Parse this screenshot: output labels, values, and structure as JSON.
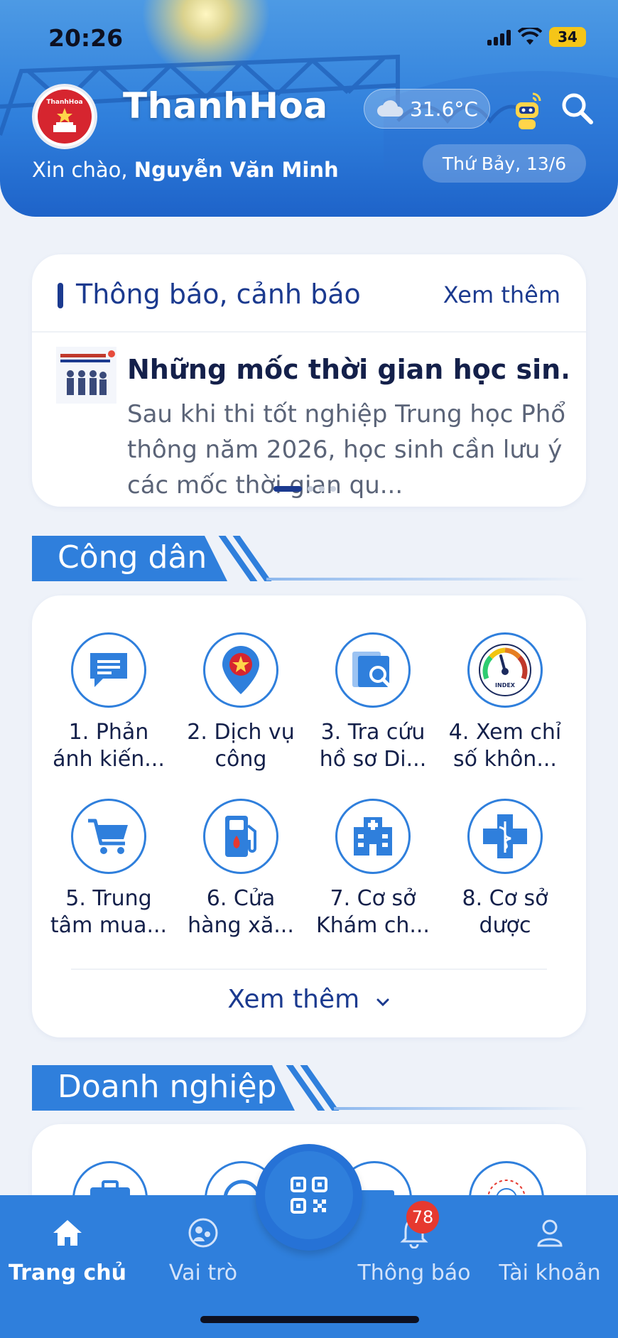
{
  "status_bar": {
    "time": "20:26",
    "battery": "34"
  },
  "header": {
    "app_title": "ThanhHoa",
    "logo_text": "ThanhHoa",
    "temperature": "31.6°C",
    "greeting_prefix": "Xin chào, ",
    "user_name": "Nguyễn Văn Minh",
    "date": "Thứ Bảy, 13/6"
  },
  "notice": {
    "title": "Thông báo, cảnh báo",
    "more_label": "Xem thêm",
    "headline": "Những mốc thời gian học sin...",
    "body": "Sau khi thi tốt nghiệp Trung học Phổ thông năm 2026, học sinh cần lưu ý các mốc thời gian qu..."
  },
  "citizen": {
    "section_title": "Công dân",
    "items": [
      {
        "label": "1. Phản ánh kiến...",
        "icon": "chat-icon"
      },
      {
        "label": "2. Dịch vụ công",
        "icon": "location-emblem-icon"
      },
      {
        "label": "3. Tra cứu hồ sơ Di...",
        "icon": "document-search-icon"
      },
      {
        "label": "4. Xem chỉ số khôn...",
        "icon": "air-quality-gauge-icon"
      },
      {
        "label": "5. Trung tâm mua...",
        "icon": "shopping-cart-icon"
      },
      {
        "label": "6. Cửa hàng xă...",
        "icon": "fuel-pump-icon"
      },
      {
        "label": "7. Cơ sở Khám ch...",
        "icon": "hospital-icon"
      },
      {
        "label": "8. Cơ sở dược",
        "icon": "pharmacy-icon"
      }
    ],
    "more_label": "Xem thêm"
  },
  "business": {
    "section_title": "Doanh nghiệp"
  },
  "bottom_nav": {
    "items": [
      {
        "label": "Trang chủ"
      },
      {
        "label": "Vai trò"
      },
      {
        "label": "Thông báo"
      },
      {
        "label": "Tài khoản"
      }
    ],
    "notification_count": "78"
  },
  "colors": {
    "primary": "#2f7fdc",
    "navy": "#1b3a8f",
    "badge": "#e6392f"
  }
}
